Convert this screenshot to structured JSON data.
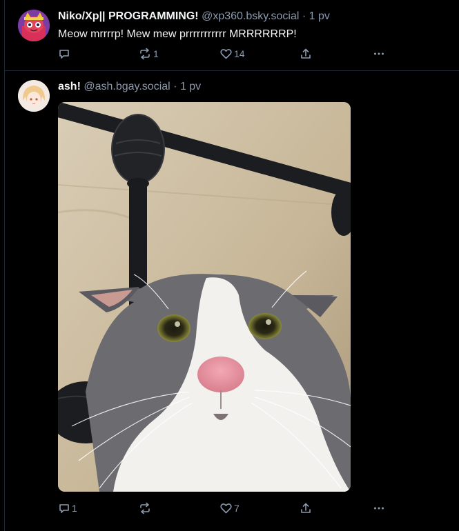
{
  "posts": [
    {
      "author_name": "Niko/Xp|| PROGRAMMING!",
      "author_handle": "@xp360.bsky.social",
      "separator": "·",
      "time": "1 pv",
      "text": "Meow mrrrrp! Mew mew prrrrrrrrrrr MRRRRRRP!",
      "reply_count": "",
      "repost_count": "1",
      "like_count": "14"
    },
    {
      "author_name": "ash!",
      "author_handle": "@ash.bgay.social",
      "separator": "·",
      "time": "1 pv",
      "text": "",
      "reply_count": "1",
      "repost_count": "",
      "like_count": "7"
    }
  ],
  "icons": [
    "reply-icon",
    "repost-icon",
    "like-icon",
    "share-icon",
    "more-icon"
  ],
  "colors": {
    "background": "#000000",
    "divider": "#1e2a38",
    "primary_text": "#f1f3f5",
    "secondary_text": "#8c9aae"
  }
}
